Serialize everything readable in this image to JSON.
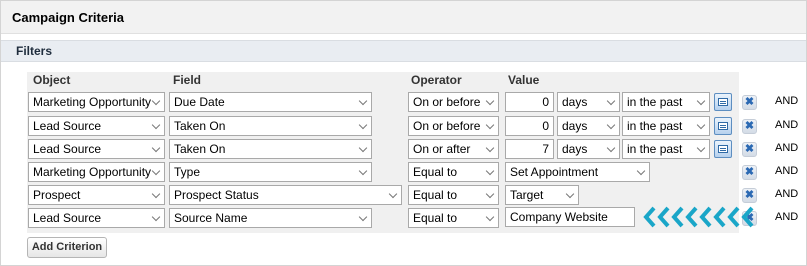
{
  "panel": {
    "title": "Campaign Criteria"
  },
  "filters": {
    "title": "Filters",
    "headers": {
      "object": "Object",
      "field": "Field",
      "operator": "Operator",
      "value": "Value"
    },
    "and_label": "AND",
    "delete_glyph": "✖",
    "add_button": "Add Criterion",
    "rows": [
      {
        "object": "Marketing Opportunity",
        "field": "Due Date",
        "operator": "On or before",
        "value": "0",
        "unit": "days",
        "direction": "in the past",
        "calendar": true
      },
      {
        "object": "Lead Source",
        "field": "Taken On",
        "operator": "On or before",
        "value": "0",
        "unit": "days",
        "direction": "in the past",
        "calendar": true
      },
      {
        "object": "Lead Source",
        "field": "Taken On",
        "operator": "On or after",
        "value": "7",
        "unit": "days",
        "direction": "in the past",
        "calendar": true
      },
      {
        "object": "Marketing Opportunity",
        "field": "Type",
        "operator": "Equal to",
        "value": "Set Appointment"
      },
      {
        "object": "Prospect",
        "field": "Prospect Status",
        "operator": "Equal to",
        "value": "Target"
      },
      {
        "object": "Lead Source",
        "field": "Source Name",
        "operator": "Equal to",
        "value": "Company Website"
      }
    ]
  },
  "colors": {
    "header_bg": "#f2f2f2",
    "filters_bg": "#e9edf2",
    "grid_bg": "#f0f0f0",
    "arrow": "#1aa6c8",
    "delete_x": "#2b69b3"
  },
  "icons": {
    "calendar": "calendar-icon",
    "delete": "close-icon",
    "arrow": "chevron-left-icon"
  }
}
